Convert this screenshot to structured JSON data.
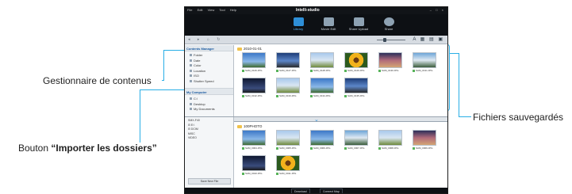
{
  "callouts": {
    "content_manager": "Gestionnaire de contenus",
    "import_folders_prefix": "Bouton ",
    "import_folders_bold": "“Importer les dossiers”",
    "saved_files": "Fichiers sauvegardés"
  },
  "colors": {
    "callout_line": "#29aee6",
    "toolbar_bg": "#0d1014",
    "active_tab": "#2e8fd8"
  },
  "app": {
    "title": "Intelli-studio",
    "menu": [
      "File",
      "Edit",
      "View",
      "Tool",
      "Help"
    ],
    "window_controls": "– □ ×",
    "toolbar": [
      {
        "label": "Library",
        "icon": "library-icon",
        "active": true
      },
      {
        "label": "Movie Edit",
        "icon": "movie-edit-icon",
        "active": false
      },
      {
        "label": "Share Upload",
        "icon": "share-upload-icon",
        "active": false
      },
      {
        "label": "Share",
        "icon": "globe-icon",
        "active": false
      }
    ],
    "subbar_icons": "◂ ▸ ⌂ ↻",
    "view_icons": "A ▦ ▤ ▣",
    "zoom_level": 0.3
  },
  "left_top": {
    "header": "Contents Manager",
    "items": [
      "Folder",
      "Date",
      "Color",
      "Location",
      "ISO",
      "Shutter Speed"
    ],
    "my_computer_header": "My Computer",
    "my_computer_items": [
      "C:\\",
      "Desktop",
      "My Documents"
    ]
  },
  "main_top": {
    "folder": "2010-01-01",
    "photos": [
      {
        "style": "p-sky",
        "name": "SAM_0126.JPG"
      },
      {
        "style": "p-blue",
        "name": "SAM_0127.JPG"
      },
      {
        "style": "p-field",
        "name": "SAM_0128.JPG"
      },
      {
        "style": "p-sun",
        "name": "SAM_0129.JPG"
      },
      {
        "style": "p-dawn",
        "name": "SAM_0130.JPG"
      },
      {
        "style": "p-lake",
        "name": "SAM_0131.JPG"
      },
      {
        "style": "p-night",
        "name": "SAM_0132.JPG"
      },
      {
        "style": "p-field",
        "name": "SAM_0133.JPG"
      },
      {
        "style": "p-sky",
        "name": "SAM_0134.JPG"
      },
      {
        "style": "p-blue",
        "name": "SAM_0135.JPG"
      }
    ]
  },
  "device": {
    "header": "Connected Device",
    "tree": [
      "SMX-F40",
      "⊟ E:\\",
      "  ⊟ DCIM",
      "    MISC",
      "    VIDEO"
    ],
    "save_button": "Save New File",
    "folder": "100PHOTO",
    "photos": [
      {
        "style": "p-sky",
        "name": "SAM_0004.JPG"
      },
      {
        "style": "p-field",
        "name": "SAM_0005.JPG"
      },
      {
        "style": "p-sky",
        "name": "SAM_0006.JPG"
      },
      {
        "style": "p-lake",
        "name": "SAM_0007.JPG"
      },
      {
        "style": "p-field",
        "name": "SAM_0008.JPG"
      },
      {
        "style": "p-dawn",
        "name": "SAM_0009.JPG"
      },
      {
        "style": "p-night",
        "name": "SAM_0010.JPG"
      },
      {
        "style": "p-sun",
        "name": "SAM_0011.JPG"
      }
    ]
  },
  "status": {
    "left_button": "Download",
    "right_button": "Connect Map"
  }
}
